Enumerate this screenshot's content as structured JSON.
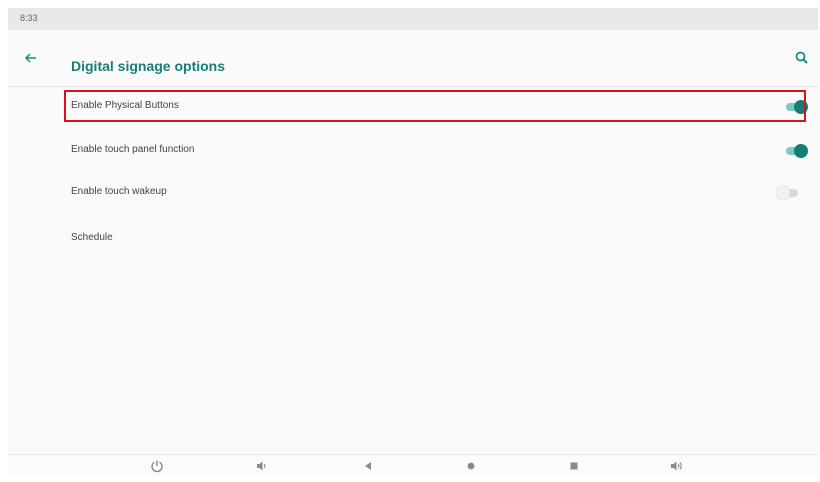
{
  "status_bar": {
    "time": "8:33"
  },
  "app_bar": {
    "title": "Digital signage options",
    "back_icon": "arrow-back-icon",
    "search_icon": "search-icon"
  },
  "settings": [
    {
      "label": "Enable Physical Buttons",
      "toggle": "on",
      "highlighted": true
    },
    {
      "label": "Enable touch panel function",
      "toggle": "on"
    },
    {
      "label": "Enable touch wakeup",
      "toggle": "off"
    },
    {
      "label": "Schedule"
    }
  ],
  "nav_bar": {
    "icons": [
      "power-icon",
      "volume-down-icon",
      "back-icon",
      "home-icon",
      "recents-icon",
      "volume-up-icon"
    ]
  },
  "colors": {
    "accent": "#127f75",
    "highlight_border": "#d2141f"
  }
}
